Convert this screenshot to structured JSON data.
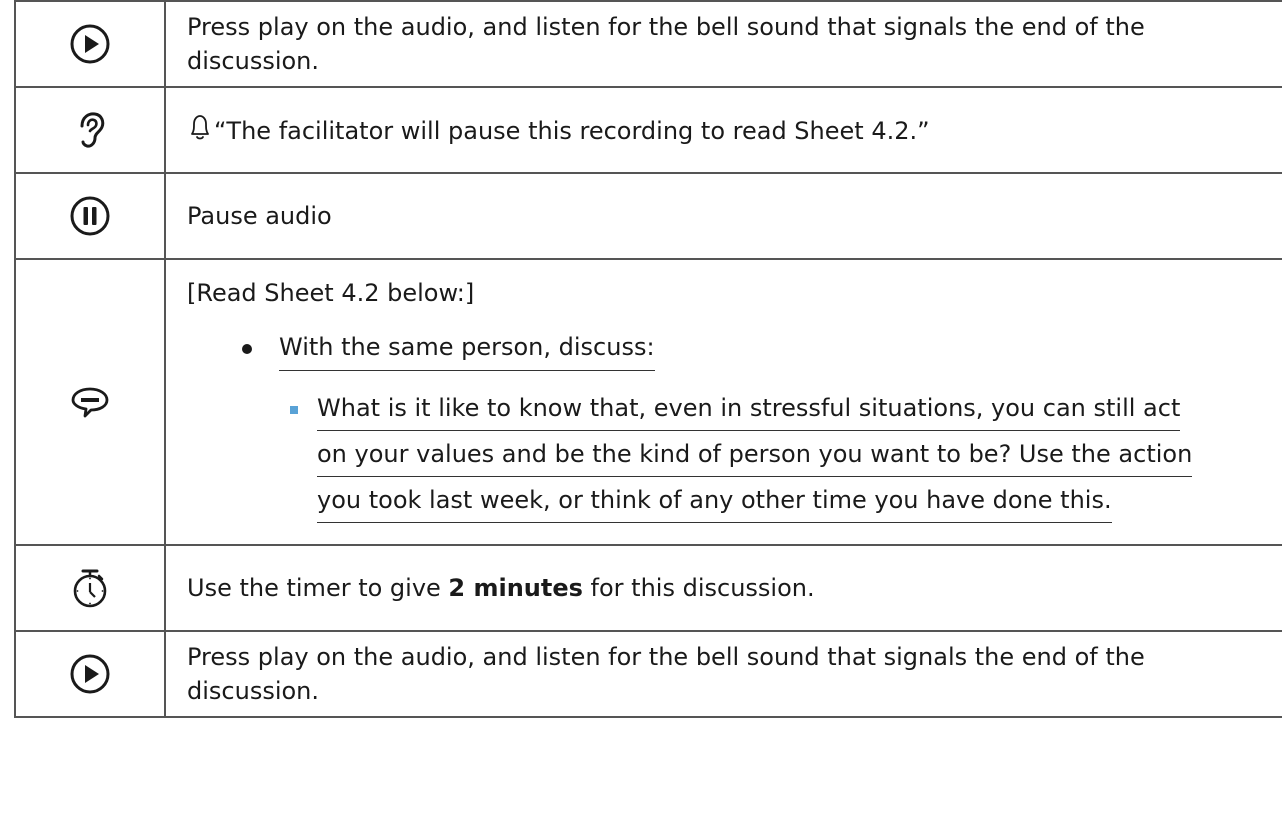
{
  "rows": [
    {
      "icon": "play-icon",
      "text": "Press play on the audio, and listen for the bell sound that signals the end of the discussion."
    },
    {
      "icon": "ear-icon",
      "quote": "“The facilitator will pause this recording to read Sheet 4.2.”"
    },
    {
      "icon": "pause-icon",
      "text": "Pause audio"
    },
    {
      "icon": "speech-bubble-icon",
      "intro": "[Read Sheet 4.2 below:]",
      "bullet": "With the same person, discuss:",
      "sub_lines": [
        "What is it like to know that, even in stressful situations, you can still act",
        "on your values and be the kind of person you want to be? Use the action",
        "you took last week, or think of any other time you have done this."
      ]
    },
    {
      "icon": "timer-icon",
      "text_before": "Use the timer to give ",
      "text_bold": "2 minutes",
      "text_after": " for this discussion."
    },
    {
      "icon": "play-icon",
      "text": "Press play on the audio, and listen for the bell sound that signals the end of the discussion."
    }
  ],
  "colors": {
    "border": "#555555",
    "text": "#1a1a1a",
    "sub_bullet": "#59a2d6"
  }
}
